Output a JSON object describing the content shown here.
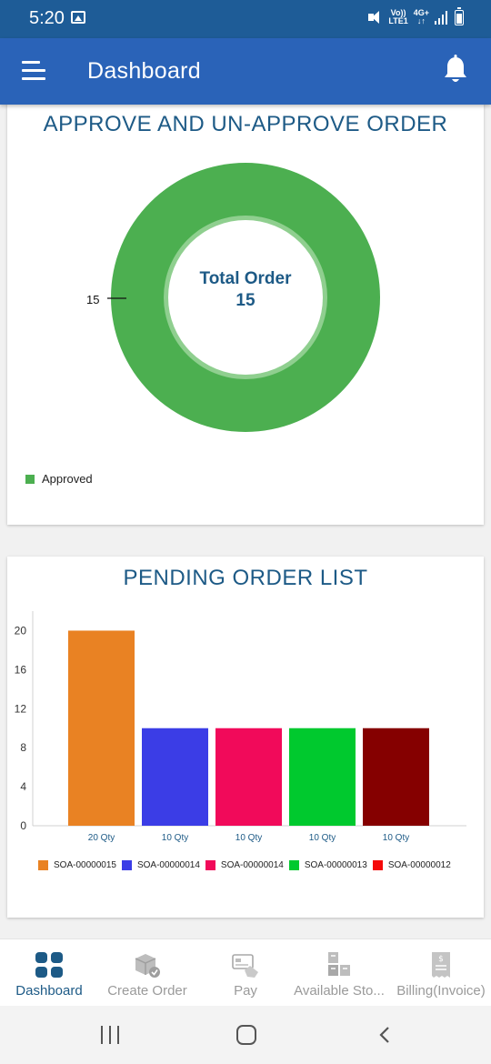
{
  "status_bar": {
    "time": "5:20",
    "volte_line1": "Vo))",
    "volte_line2": "LTE1",
    "network_line1": "4G+",
    "network_line2": "↓↑"
  },
  "app_bar": {
    "title": "Dashboard",
    "menu_icon": "hamburger-menu-icon",
    "notification_icon": "bell-icon"
  },
  "approve_card": {
    "title": "APPROVE AND UN-APPROVE ORDER",
    "center_label_line1": "Total Order",
    "center_label_line2": "15",
    "slice_label": "15",
    "legend_label": "Approved"
  },
  "pending_card": {
    "title": "PENDING ORDER LIST"
  },
  "chart_data": [
    {
      "type": "pie",
      "title": "APPROVE AND UN-APPROVE ORDER",
      "subtitle": "",
      "categories": [
        "Approved"
      ],
      "values": [
        15
      ],
      "colors": [
        "#4caf50"
      ],
      "legend": "bottom-left"
    },
    {
      "type": "bar",
      "title": "PENDING ORDER LIST",
      "categories": [
        "20 Qty",
        "10 Qty",
        "10 Qty",
        "10 Qty",
        "10 Qty"
      ],
      "values": [
        20,
        10,
        10,
        10,
        10
      ],
      "colors": [
        "#e98223",
        "#3b3de6",
        "#f10a5a",
        "#00c92e",
        "#850000"
      ],
      "yticks": [
        0,
        4,
        8,
        12,
        16,
        20
      ],
      "ylim": [
        0,
        22
      ],
      "legend_entries": [
        {
          "label": "SOA-00000015",
          "color": "#e98223"
        },
        {
          "label": "SOA-00000014",
          "color": "#3b3de6"
        },
        {
          "label": "SOA-00000014",
          "color": "#f10a5a"
        },
        {
          "label": "SOA-00000013",
          "color": "#00c92e"
        },
        {
          "label": "SOA-00000012",
          "color": "#f50a0a"
        }
      ],
      "legend": "bottom",
      "grid": false
    }
  ],
  "bottom_nav": {
    "items": [
      {
        "label": "Dashboard",
        "icon": "dashboard-grid-icon",
        "active": true
      },
      {
        "label": "Create Order",
        "icon": "package-check-icon",
        "active": false
      },
      {
        "label": "Pay",
        "icon": "card-payment-icon",
        "active": false
      },
      {
        "label": "Available Sto...",
        "icon": "stock-boxes-icon",
        "active": false
      },
      {
        "label": "Billing(Invoice)",
        "icon": "invoice-receipt-icon",
        "active": false
      }
    ]
  },
  "colors": {
    "status_bar": "#1e5c97",
    "app_bar": "#2a63b8",
    "title_text": "#1d5a86",
    "approved": "#4caf50"
  }
}
